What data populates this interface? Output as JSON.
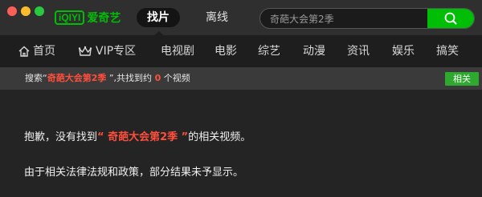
{
  "app": {
    "logo_mark": "iQIYI",
    "logo_text": "爱奇艺"
  },
  "top_tabs": {
    "active": "找片",
    "offline": "离线"
  },
  "search": {
    "value": "奇葩大会第2季"
  },
  "nav": {
    "items": [
      "首页",
      "VIP专区",
      "电视剧",
      "电影",
      "综艺",
      "动漫",
      "资讯",
      "娱乐",
      "搞笑"
    ]
  },
  "info": {
    "prefix": "搜索“",
    "query": "奇葩大会第2季",
    "middle": " ”,共找到约 ",
    "count": "0",
    "suffix": " 个视频",
    "related_label": "相关"
  },
  "message": {
    "line1_prefix": "抱歉，没有找到",
    "line1_query": "“ 奇葩大会第2季 ”",
    "line1_suffix": "的相关视频。",
    "line2": "由于相关法律法规和政策，部分结果未予显示。"
  },
  "colors": {
    "brand_green": "#00be06",
    "highlight_red": "#ff4f3c"
  }
}
